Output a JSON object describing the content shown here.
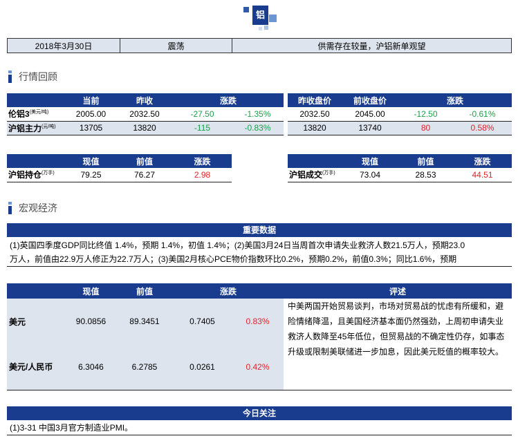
{
  "logo": {
    "text": "铝"
  },
  "header": {
    "date": "2018年3月30日",
    "trend": "震荡",
    "summary": "供需存在较量，沪铝新单观望"
  },
  "sections": {
    "market": "行情回顾",
    "macro": "宏观经济"
  },
  "quote_table": {
    "headers": [
      "当前",
      "昨收",
      "涨跌",
      "昨收盘价",
      "前收盘价",
      "涨跌"
    ],
    "rows": [
      {
        "name": "伦铝3",
        "unit": "(美元/吨)",
        "cur": "2005.00",
        "prev": "2032.50",
        "chg": "-27.50",
        "pct": "-1.35%",
        "close_prev": "2032.50",
        "close_before": "2045.00",
        "chg2": "-12.50",
        "pct2": "-0.61%"
      },
      {
        "name": "沪铝主力",
        "unit": "(元/吨)",
        "cur": "13705",
        "prev": "13820",
        "chg": "-115",
        "pct": "-0.83%",
        "close_prev": "13820",
        "close_before": "13740",
        "chg2": "80",
        "pct2": "0.58%"
      }
    ]
  },
  "position_table": {
    "headers": [
      "现值",
      "前值",
      "涨跌"
    ],
    "name": "沪铝持仓",
    "unit": "(万手)",
    "cur": "79.25",
    "prev": "76.27",
    "chg": "2.98"
  },
  "volume_table": {
    "headers": [
      "现值",
      "前值",
      "涨跌"
    ],
    "name": "沪铝成交",
    "unit": "(万手)",
    "cur": "73.04",
    "prev": "28.53",
    "chg": "44.51"
  },
  "key_data": {
    "title": "重要数据",
    "line1": "(1)英国四季度GDP同比终值 1.4%，预期 1.4%，初值 1.4%；(2)美国3月24日当周首次申请失业救济人数21.5万人，预期23.0",
    "line2": "万人，前值由22.9万人修正为22.7万人；(3)美国2月核心PCE物价指数环比0.2%，预期0.2%，前值0.3%；同比1.6%，预期"
  },
  "fx_table": {
    "headers": [
      "现值",
      "前值",
      "涨跌",
      "评述"
    ],
    "rows": [
      {
        "name": "美元",
        "cur": "90.0856",
        "prev": "89.3451",
        "chg": "0.7405",
        "pct": "0.83%"
      },
      {
        "name": "美元/人民币",
        "cur": "6.3046",
        "prev": "6.2785",
        "chg": "0.0261",
        "pct": "0.42%"
      }
    ],
    "comment": "中美两国开始贸易谈判，市场对贸易战的忧虑有所缓和，避险情绪降温，且美国经济基本面仍然强劲，上周初申请失业救济人数降至45年低位，但贸易战的不确定性仍存，如事态升级或限制美联储进一步加息，因此美元贬值的概率较大。"
  },
  "today_focus": {
    "title": "今日关注",
    "item": "(1)3-31 中国3月官方制造业PMI。"
  },
  "colors": {
    "header_blue": "#1a3c8e",
    "shade": "#dde4ee",
    "up": "#e0232b",
    "down": "#1aa04a"
  }
}
